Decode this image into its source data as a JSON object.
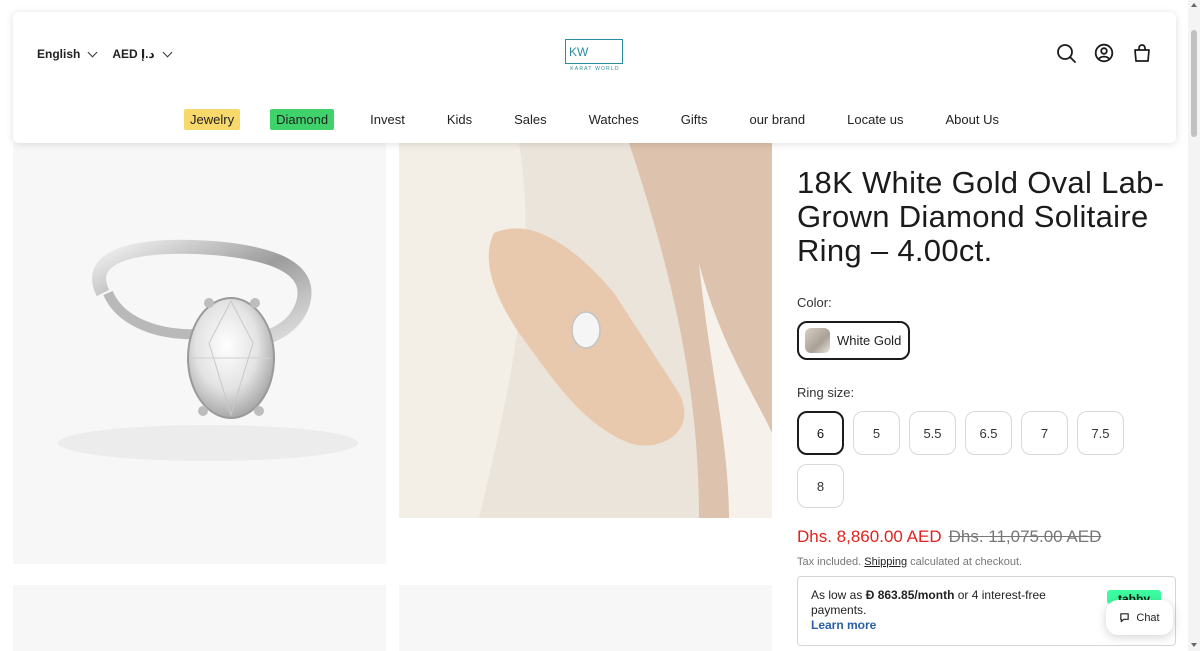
{
  "header": {
    "language": "English",
    "currency": "AED د.إ",
    "logo_mark": "KW",
    "logo_text": "KARAT WORLD",
    "icons": [
      "search-icon",
      "account-icon",
      "cart-icon"
    ]
  },
  "nav": {
    "items": [
      {
        "label": "Jewelry",
        "highlight": "#f6d86b"
      },
      {
        "label": "Diamond",
        "highlight": "#3fd26b"
      },
      {
        "label": "Invest"
      },
      {
        "label": "Kids"
      },
      {
        "label": "Sales"
      },
      {
        "label": "Watches"
      },
      {
        "label": "Gifts"
      },
      {
        "label": "our brand"
      },
      {
        "label": "Locate us"
      },
      {
        "label": "About Us"
      }
    ]
  },
  "product": {
    "title": "18K White Gold Oval Lab-Grown Diamond Solitaire Ring – 4.00ct.",
    "color_label": "Color:",
    "color_selected": "White Gold",
    "size_label": "Ring size:",
    "sizes": [
      "6",
      "5",
      "5.5",
      "6.5",
      "7",
      "7.5",
      "8"
    ],
    "size_selected": "6",
    "price_now": "Dhs. 8,860.00 AED",
    "price_old": "Dhs. 11,075.00 AED",
    "tax_prefix": "Tax included.",
    "tax_link": "Shipping",
    "tax_suffix": "calculated at checkout.",
    "accent_color": "#e0231c"
  },
  "tabby": {
    "prefix": "As low as",
    "amount": "Ð 863.85/month",
    "suffix": "or 4 interest-free payments.",
    "learn_more": "Learn more",
    "badge": "tabby",
    "badge_color": "#3cfca0"
  },
  "chat": {
    "label": "Chat"
  }
}
